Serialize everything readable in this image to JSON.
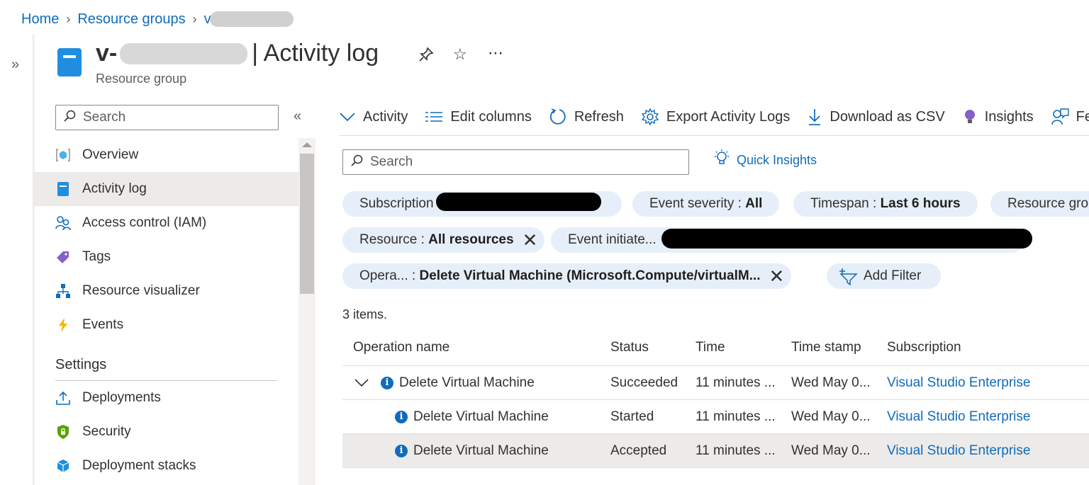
{
  "breadcrumb": {
    "home": "Home",
    "resource_groups": "Resource groups",
    "current": "v"
  },
  "header": {
    "title_prefix": "v-",
    "title_suffix": "| Activity log",
    "subtitle": "Resource group",
    "pin_icon": "pin-icon",
    "star_icon": "star-icon",
    "more_icon": "more-icon"
  },
  "sidebar": {
    "search_placeholder": "Search",
    "items": [
      {
        "label": "Overview",
        "icon": "overview-icon"
      },
      {
        "label": "Activity log",
        "icon": "activity-log-icon",
        "active": true
      },
      {
        "label": "Access control (IAM)",
        "icon": "iam-icon"
      },
      {
        "label": "Tags",
        "icon": "tag-icon"
      },
      {
        "label": "Resource visualizer",
        "icon": "visualizer-icon"
      },
      {
        "label": "Events",
        "icon": "lightning-icon"
      }
    ],
    "settings_heading": "Settings",
    "settings_items": [
      {
        "label": "Deployments",
        "icon": "upload-icon"
      },
      {
        "label": "Security",
        "icon": "shield-icon"
      },
      {
        "label": "Deployment stacks",
        "icon": "cube-icon"
      }
    ]
  },
  "toolbar": {
    "activity": "Activity",
    "edit_columns": "Edit columns",
    "refresh": "Refresh",
    "export": "Export Activity Logs",
    "download": "Download as CSV",
    "insights": "Insights",
    "feedback": "Fee"
  },
  "filters": {
    "search_placeholder": "Search",
    "quick_insights": "Quick Insights",
    "subscription_label": "Subscription",
    "event_severity_label": "Event severity :",
    "event_severity_value": "All",
    "timespan_label": "Timespan :",
    "timespan_value": "Last 6 hours",
    "resource_group_label": "Resource grou",
    "resource_label": "Resource :",
    "resource_value": "All resources",
    "event_initiated_label": "Event initiate...",
    "operation_label": "Opera...  :",
    "operation_value": "Delete Virtual Machine (Microsoft.Compute/virtualM...",
    "add_filter": "Add Filter"
  },
  "results": {
    "count": "3 items.",
    "columns": [
      "Operation name",
      "Status",
      "Time",
      "Time stamp",
      "Subscription"
    ],
    "rows": [
      {
        "operation": "Delete Virtual Machine",
        "status": "Succeeded",
        "time": "11 minutes ...",
        "timestamp": "Wed May 0...",
        "subscription": "Visual Studio Enterprise"
      },
      {
        "operation": "Delete Virtual Machine",
        "status": "Started",
        "time": "11 minutes ...",
        "timestamp": "Wed May 0...",
        "subscription": "Visual Studio Enterprise"
      },
      {
        "operation": "Delete Virtual Machine",
        "status": "Accepted",
        "time": "11 minutes ...",
        "timestamp": "Wed May 0...",
        "subscription": "Visual Studio Enterprise"
      }
    ]
  },
  "colors": {
    "accent": "#0f6cbd",
    "pill_bg": "#e6eff9",
    "selected_bg": "#edebe9"
  }
}
